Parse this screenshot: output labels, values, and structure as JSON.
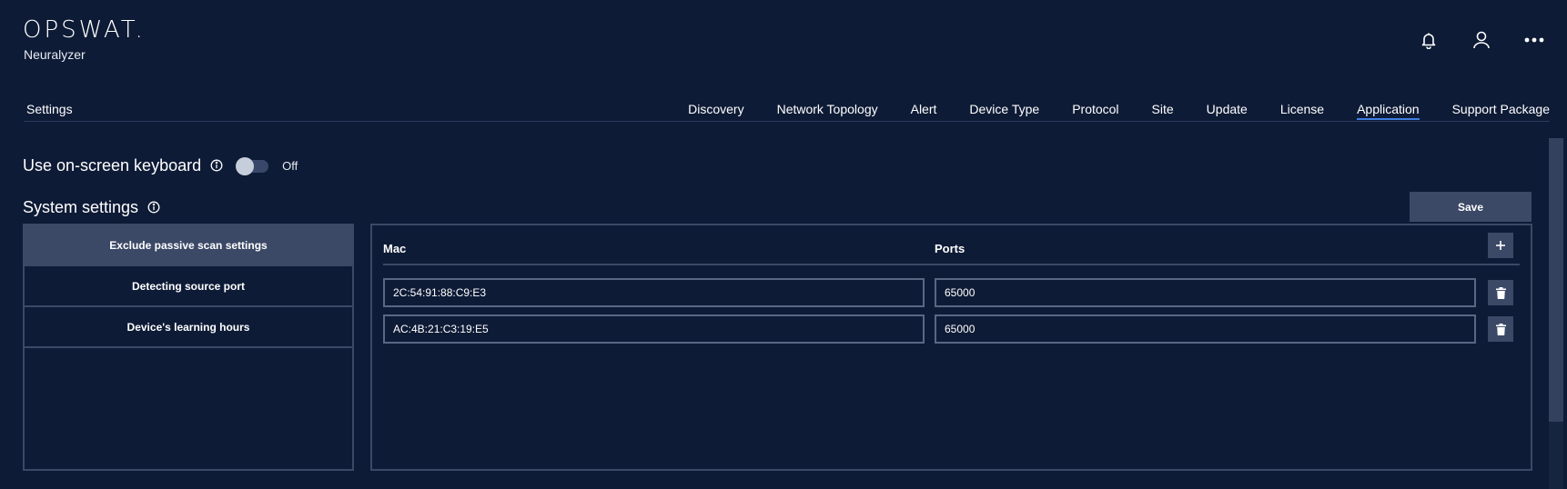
{
  "brand": {
    "logo": "OPSWAT.",
    "product": "Neuralyzer"
  },
  "header_icons": [
    "bell-icon",
    "user-icon",
    "more-icon"
  ],
  "nav": {
    "title": "Settings",
    "tabs": [
      {
        "label": "Discovery"
      },
      {
        "label": "Network Topology"
      },
      {
        "label": "Alert"
      },
      {
        "label": "Device Type"
      },
      {
        "label": "Protocol"
      },
      {
        "label": "Site"
      },
      {
        "label": "Update"
      },
      {
        "label": "License"
      },
      {
        "label": "Application",
        "active": true
      },
      {
        "label": "Support Package"
      }
    ]
  },
  "keyboard": {
    "label": "Use on-screen keyboard",
    "toggle_state": "Off"
  },
  "system": {
    "label": "System settings",
    "save_label": "Save",
    "menu": [
      {
        "label": "Exclude passive scan settings",
        "active": true
      },
      {
        "label": "Detecting source port"
      },
      {
        "label": "Device's learning hours"
      }
    ]
  },
  "table": {
    "columns": {
      "mac": "Mac",
      "ports": "Ports"
    },
    "rows": [
      {
        "mac": "2C:54:91:88:C9:E3",
        "port": "65000"
      },
      {
        "mac": "AC:4B:21:C3:19:E5",
        "port": "65000"
      }
    ]
  },
  "colors": {
    "background": "#0e1b36",
    "panel_border": "#3b4866",
    "accent": "#3f7fe0",
    "text": "#ffffff"
  }
}
